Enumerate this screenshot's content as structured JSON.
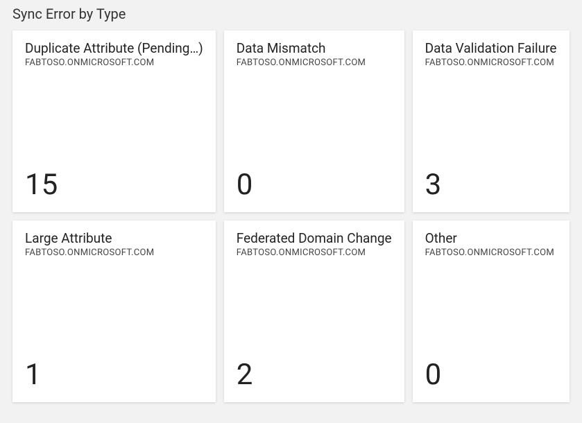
{
  "panel": {
    "title": "Sync Error by Type"
  },
  "tiles": [
    {
      "title": "Duplicate Attribute (Pending…)",
      "subtitle": "FABTOSO.ONMICROSOFT.COM",
      "value": "15"
    },
    {
      "title": "Data Mismatch",
      "subtitle": "FABTOSO.ONMICROSOFT.COM",
      "value": "0"
    },
    {
      "title": "Data Validation Failure",
      "subtitle": "FABTOSO.ONMICROSOFT.COM",
      "value": "3"
    },
    {
      "title": "Large Attribute",
      "subtitle": "FABTOSO.ONMICROSOFT.COM",
      "value": "1"
    },
    {
      "title": "Federated Domain Change",
      "subtitle": "FABTOSO.ONMICROSOFT.COM",
      "value": "2"
    },
    {
      "title": "Other",
      "subtitle": "FABTOSO.ONMICROSOFT.COM",
      "value": "0"
    }
  ]
}
